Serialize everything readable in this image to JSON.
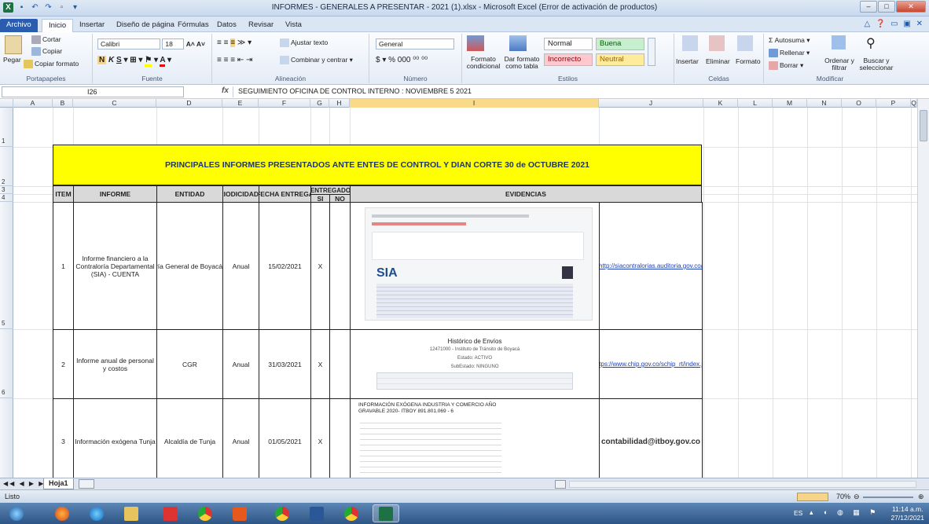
{
  "window": {
    "title": "INFORMES - GENERALES A PRESENTAR - 2021 (1).xlsx - Microsoft Excel (Error de activación de productos)"
  },
  "tabs": [
    "Archivo",
    "Inicio",
    "Insertar",
    "Diseño de página",
    "Fórmulas",
    "Datos",
    "Revisar",
    "Vista"
  ],
  "ribbon": {
    "clipboard": {
      "cut": "Cortar",
      "copy": "Copiar",
      "paste": "Pegar",
      "format_painter": "Copiar formato",
      "label": "Portapapeles"
    },
    "font": {
      "name": "Calibri",
      "size": "18",
      "label": "Fuente"
    },
    "alignment": {
      "wrap": "Ajustar texto",
      "merge": "Combinar y centrar",
      "label": "Alineación"
    },
    "number": {
      "format": "General",
      "label": "Número"
    },
    "styles": {
      "conditional": "Formato condicional",
      "as_table": "Dar formato como tabla",
      "normal": "Normal",
      "good": "Buena",
      "bad": "Incorrecto",
      "neutral": "Neutral",
      "label": "Estilos"
    },
    "cells": {
      "insert": "Insertar",
      "delete": "Eliminar",
      "format": "Formato",
      "label": "Celdas"
    },
    "editing": {
      "autosum": "Autosuma",
      "fill": "Rellenar",
      "clear": "Borrar",
      "sort": "Ordenar y filtrar",
      "find": "Buscar y seleccionar",
      "label": "Modificar"
    }
  },
  "formula_bar": {
    "name_box": "I26",
    "fx": "fx",
    "content": "SEGUIMIENTO OFICINA DE CONTROL INTERNO : NOVIEMBRE  5 2021"
  },
  "columns": [
    "A",
    "B",
    "C",
    "D",
    "E",
    "F",
    "G",
    "H",
    "I",
    "J",
    "K",
    "L",
    "M",
    "N",
    "O",
    "P",
    "Q"
  ],
  "rows": [
    "1",
    "2",
    "3",
    "4",
    "5",
    "6"
  ],
  "sheet": {
    "title": "PRINCIPALES INFORMES PRESENTADOS ANTE ENTES DE CONTROL Y DIAN CORTE 30 de OCTUBRE  2021",
    "headers": {
      "item": "ITEM",
      "informe": "INFORME",
      "entidad": "ENTIDAD",
      "periodicidad": "PERIODICIDAD",
      "fecha": "FECHA ENTREGA",
      "entregado": "ENTREGADO",
      "si": "SI",
      "no": "NO",
      "evidencias": "EVIDENCIAS"
    },
    "rows": [
      {
        "item": "1",
        "informe": "Informe financiero a la Contraloría Departamental (SIA) - CUENTA",
        "entidad": "Contraloría General de Boyacá",
        "periodicidad": "Anual",
        "fecha": "15/02/2021",
        "si": "X",
        "link": "http://siacontralorias.auditoria.gov.co/"
      },
      {
        "item": "2",
        "informe": "Informe anual de personal y costos",
        "entidad": "CGR",
        "periodicidad": "Anual",
        "fecha": "31/03/2021",
        "si": "X",
        "link": "https://www.chip.gov.co/schip_rt/index.jsf"
      },
      {
        "item": "3",
        "informe": "Información exógena Tunja",
        "entidad": "Alcaldía de Tunja",
        "periodicidad": "Anual",
        "fecha": "01/05/2021",
        "si": "X",
        "link": "contabilidad@itboy.gov.co"
      }
    ],
    "evidence2": {
      "title": "Histórico de Envíos",
      "sub": "12471000 - Instituto de Tránsito de Boyacá",
      "estado": "Estado: ACTIVO",
      "subestado": "SubEstado: NINGUNO"
    },
    "evidence3": {
      "title": "INFORMACIÓN EXÓGENA INDUSTRIA Y COMERCIO AÑO GRAVABLE 2020- ITBOY 891.801.069 - 6"
    }
  },
  "sheet_tabs": [
    "Hoja1"
  ],
  "status": {
    "ready": "Listo",
    "zoom": "70%"
  },
  "taskbar": {
    "lang": "ES",
    "time": "11:14 a.m.",
    "date": "27/12/2021"
  },
  "colors": {
    "title_fill": "#ffff00",
    "header_fill": "#d9d9d9",
    "link": "#1f3fb5"
  }
}
